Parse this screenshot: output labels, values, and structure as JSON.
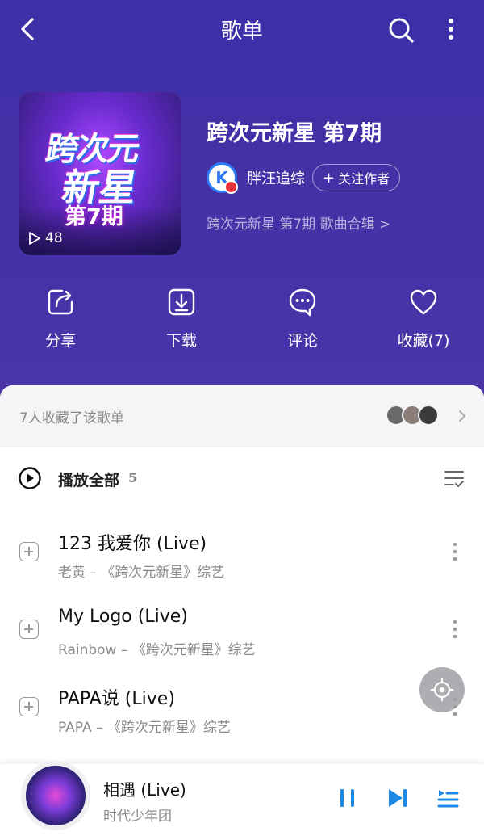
{
  "header": {
    "title": "歌单"
  },
  "playlist": {
    "cover_logo_line1": "跨次元",
    "cover_logo_line2": "新星",
    "cover_issue": "第7期",
    "play_count": "48",
    "title": "跨次元新星 第7期",
    "creator": {
      "name": "胖汪追综",
      "avatar_letter": "K",
      "follow_label": "关注作者"
    },
    "description": "跨次元新星 第7期 歌曲合辑 >"
  },
  "actions": [
    {
      "label": "分享",
      "icon": "share-icon"
    },
    {
      "label": "下载",
      "icon": "download-icon"
    },
    {
      "label": "评论",
      "icon": "comment-icon"
    },
    {
      "label": "收藏(7)",
      "icon": "heart-icon"
    }
  ],
  "collectors": {
    "text": "7人收藏了该歌单"
  },
  "play_all": {
    "label": "播放全部",
    "count": "5"
  },
  "songs": [
    {
      "title": "123 我爱你 (Live)",
      "subtitle": "老黄 – 《跨次元新星》综艺"
    },
    {
      "title": "My Logo (Live)",
      "subtitle": "Rainbow – 《跨次元新星》综艺"
    },
    {
      "title": "PAPA说 (Live)",
      "subtitle": "PAPA – 《跨次元新星》综艺"
    }
  ],
  "now_playing": {
    "title": "相遇 (Live)",
    "artist": "时代少年团"
  },
  "colors": {
    "hero_bg": "#4431a6",
    "accent_blue": "#1e88e5",
    "creator_blue": "#2d7cf6"
  }
}
